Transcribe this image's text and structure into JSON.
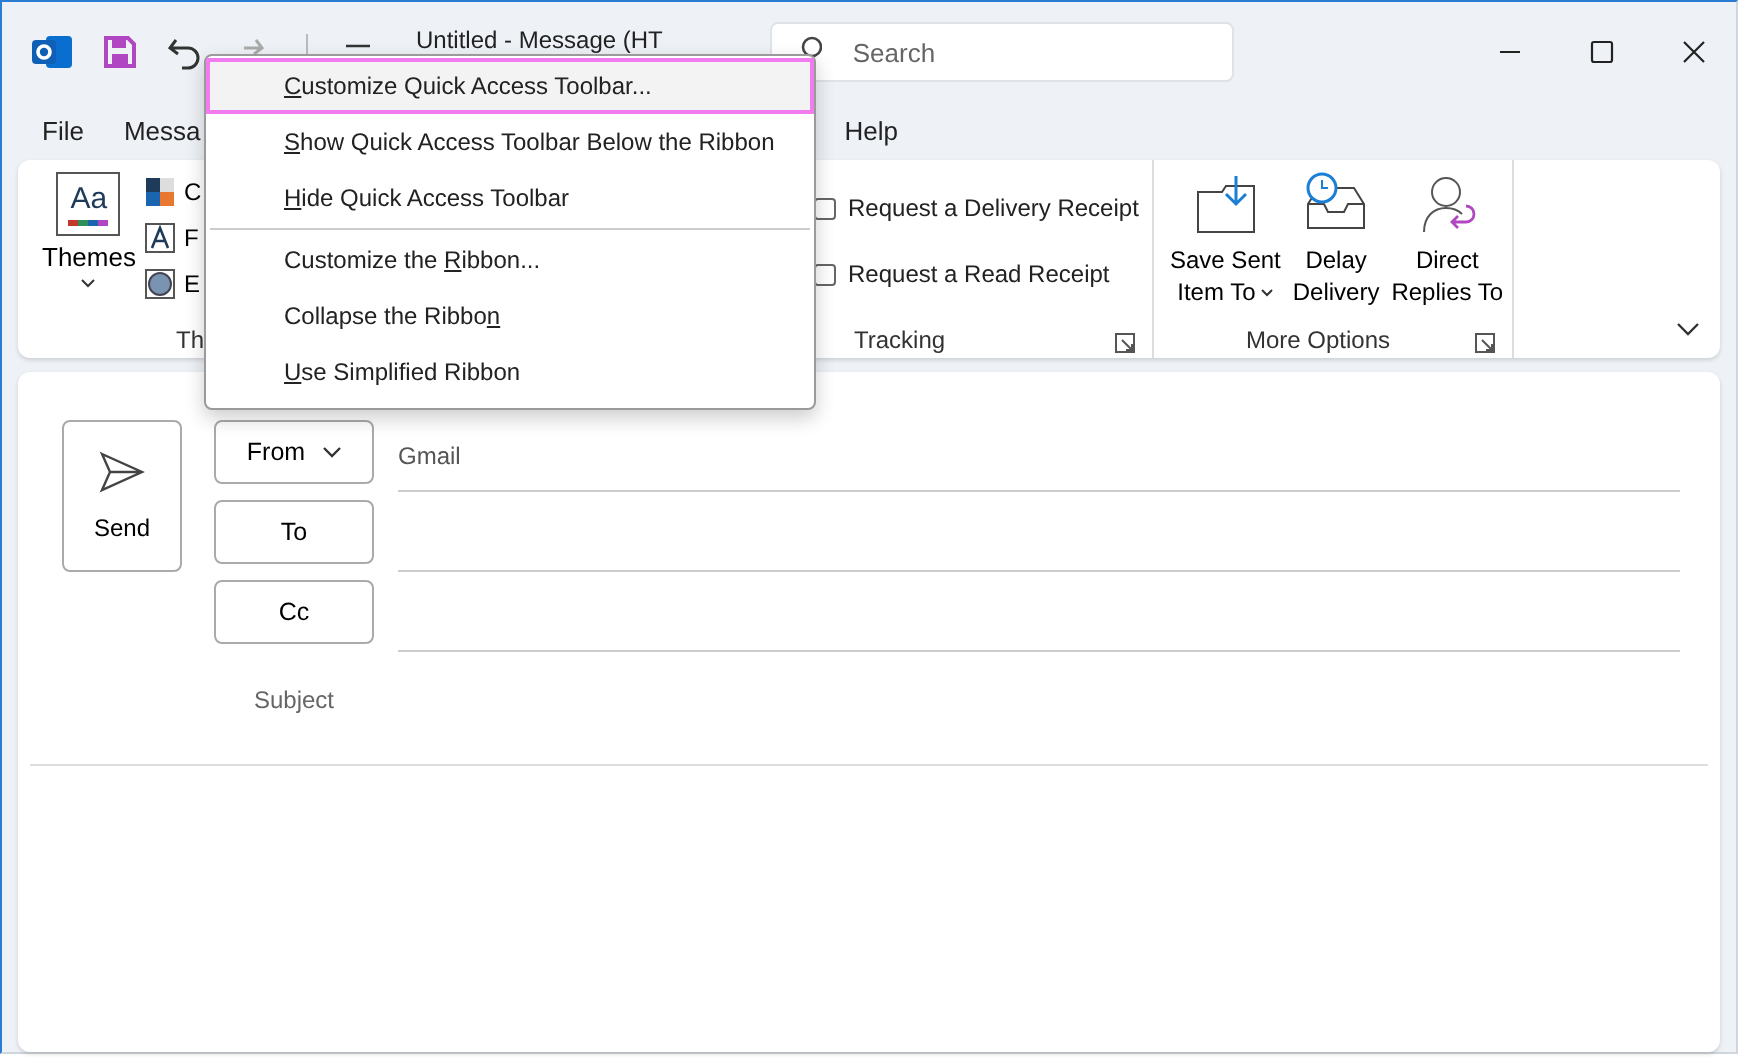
{
  "window": {
    "title": "Untitled - Message (HT"
  },
  "quick_access": {
    "search": {
      "placeholder": "Search"
    }
  },
  "tabs": [
    {
      "label": "File",
      "selected": false
    },
    {
      "label": "Messa",
      "selected": false
    },
    {
      "label": "Help",
      "selected": false
    }
  ],
  "ribbon": {
    "themes_group": {
      "icon_text": "Aa",
      "button": "Themes",
      "items": [
        "C",
        "F",
        "E"
      ],
      "label": "Th"
    },
    "tracking_group": {
      "label": "Tracking",
      "checkboxes": [
        {
          "label": "Request a Delivery Receipt",
          "checked": false
        },
        {
          "label": "Request a Read Receipt",
          "checked": false
        }
      ]
    },
    "more_options_group": {
      "label": "More Options",
      "buttons": [
        {
          "kind": "save",
          "lines": [
            "Save Sent",
            "Item To"
          ],
          "dropdown": true
        },
        {
          "kind": "delay",
          "lines": [
            "Delay",
            "Delivery"
          ],
          "dropdown": false
        },
        {
          "kind": "replies",
          "lines": [
            "Direct",
            "Replies To"
          ],
          "dropdown": false
        }
      ]
    }
  },
  "compose": {
    "send": "Send",
    "from": {
      "label": "From",
      "value": "Gmail"
    },
    "to": {
      "label": "To"
    },
    "cc": {
      "label": "Cc"
    },
    "subject": {
      "label": "Subject"
    }
  },
  "context_menu": {
    "items": [
      {
        "access_key": "C",
        "text_after": "ustomize Quick Access Toolbar...",
        "selected": true,
        "separator_after": false
      },
      {
        "access_key": "S",
        "text_after": "how Quick Access Toolbar Below the Ribbon",
        "selected": false,
        "separator_after": false
      },
      {
        "access_key": "H",
        "text_after": "ide Quick Access Toolbar",
        "selected": false,
        "separator_after": true
      },
      {
        "text_before": "Customize the ",
        "access_key": "R",
        "text_after": "ibbon...",
        "selected": false,
        "separator_after": false
      },
      {
        "text_before": "Collapse the Ribbo",
        "access_key": "n",
        "selected": false,
        "separator_after": false
      },
      {
        "access_key": "U",
        "text_after": "se Simplified Ribbon",
        "selected": false,
        "separator_after": false
      }
    ]
  }
}
